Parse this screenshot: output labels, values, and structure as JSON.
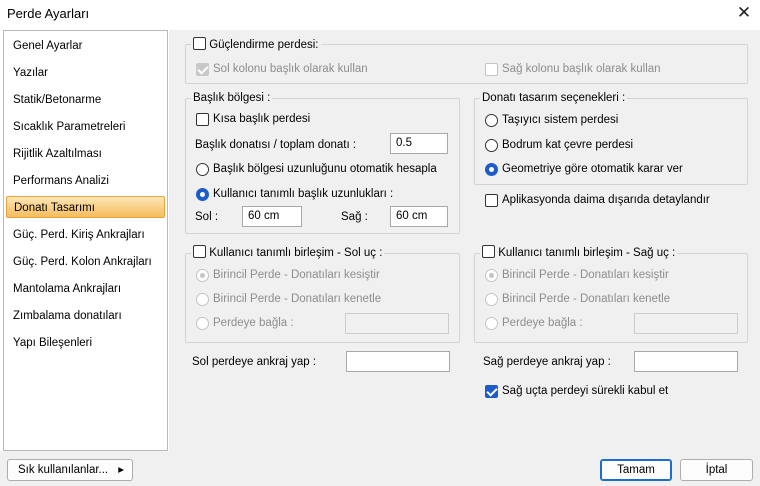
{
  "window": {
    "title": "Perde Ayarları",
    "close_glyph": "✕"
  },
  "sidebar": {
    "items": [
      {
        "label": "Genel Ayarlar"
      },
      {
        "label": "Yazılar"
      },
      {
        "label": "Statik/Betonarme"
      },
      {
        "label": "Sıcaklık Parametreleri"
      },
      {
        "label": "Rijitlik Azaltılması"
      },
      {
        "label": "Performans Analizi"
      },
      {
        "label": "Donatı Tasarımı",
        "selected": true
      },
      {
        "label": "Güç. Perd. Kiriş Ankrajları"
      },
      {
        "label": "Güç. Perd. Kolon Ankrajları"
      },
      {
        "label": "Mantolama Ankrajları"
      },
      {
        "label": "Zımbalama donatıları"
      },
      {
        "label": "Yapı Bileşenleri"
      }
    ]
  },
  "gucl": {
    "label": "Güçlendirme perdesi:",
    "checked": false,
    "left_col": {
      "label": "Sol kolonu başlık olarak kullan",
      "checked": true,
      "enabled": false
    },
    "right_col": {
      "label": "Sağ kolonu başlık olarak kullan",
      "checked": false,
      "enabled": false
    }
  },
  "baslik": {
    "legend": "Başlık bölgesi :",
    "short_flange": {
      "label": "Kısa başlık perdesi",
      "checked": false
    },
    "ratio_label": "Başlık donatısı / toplam donatı :",
    "ratio_value": "0.5",
    "auto_radio": {
      "label": "Başlık bölgesi uzunluğunu otomatik hesapla",
      "selected": false
    },
    "user_radio": {
      "label": "Kullanıcı tanımlı başlık uzunlukları :",
      "selected": true
    },
    "left_label": "Sol :",
    "left_value": "60 cm",
    "right_label": "Sağ :",
    "right_value": "60 cm"
  },
  "donati": {
    "legend": "Donatı tasarım seçenekleri :",
    "options": [
      {
        "label": "Taşıyıcı sistem perdesi",
        "selected": false
      },
      {
        "label": "Bodrum kat çevre perdesi",
        "selected": false
      },
      {
        "label": "Geometriye göre otomatik karar ver",
        "selected": true
      }
    ],
    "app_detail": {
      "label": "Aplikasyonda daima dışarıda detaylandır",
      "checked": false
    }
  },
  "sol_uc": {
    "legend": "Kullanıcı tanımlı birleşim - Sol uç :",
    "checked": false,
    "options": [
      {
        "label": "Birincil Perde - Donatıları kesiştir",
        "selected": true
      },
      {
        "label": "Birincil Perde - Donatıları kenetle",
        "selected": false
      },
      {
        "label": "Perdeye bağla :",
        "selected": false
      }
    ],
    "wall_value": ""
  },
  "sag_uc": {
    "legend": "Kullanıcı tanımlı birleşim - Sağ uç :",
    "checked": false,
    "options": [
      {
        "label": "Birincil Perde - Donatıları kesiştir",
        "selected": true
      },
      {
        "label": "Birincil Perde - Donatıları kenetle",
        "selected": false
      },
      {
        "label": "Perdeye bağla :",
        "selected": false
      }
    ],
    "wall_value": ""
  },
  "anchor": {
    "left_label": "Sol perdeye ankraj yap :",
    "left_value": "",
    "right_label": "Sağ perdeye ankraj yap :",
    "right_value": "",
    "continuous": {
      "label": "Sağ uçta perdeyi sürekli kabul et",
      "checked": true
    }
  },
  "footer": {
    "favorites_label": "Sık kullanılanlar...",
    "favorites_arrow": "▸",
    "ok_label": "Tamam",
    "cancel_label": "İptal"
  }
}
